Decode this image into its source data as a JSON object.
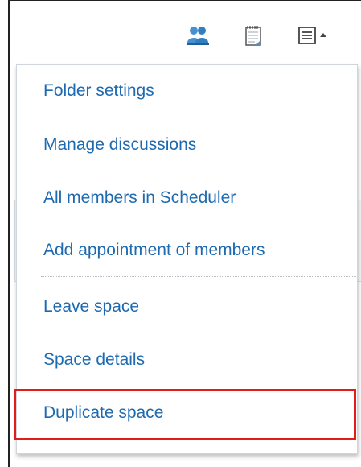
{
  "toolbar": {
    "icons": [
      "members-icon",
      "memo-icon",
      "menu-icon"
    ]
  },
  "menu": {
    "items": [
      {
        "label": "Folder settings"
      },
      {
        "label": "Manage discussions"
      },
      {
        "label": "All members in Scheduler"
      },
      {
        "label": "Add appointment of members"
      },
      {
        "label": "Leave space"
      },
      {
        "label": "Space details"
      },
      {
        "label": "Duplicate space"
      }
    ],
    "highlighted": "Duplicate space"
  },
  "colors": {
    "link": "#1e6ab0",
    "highlight": "#e21b1b",
    "members_icon": "#2f7fc1"
  }
}
